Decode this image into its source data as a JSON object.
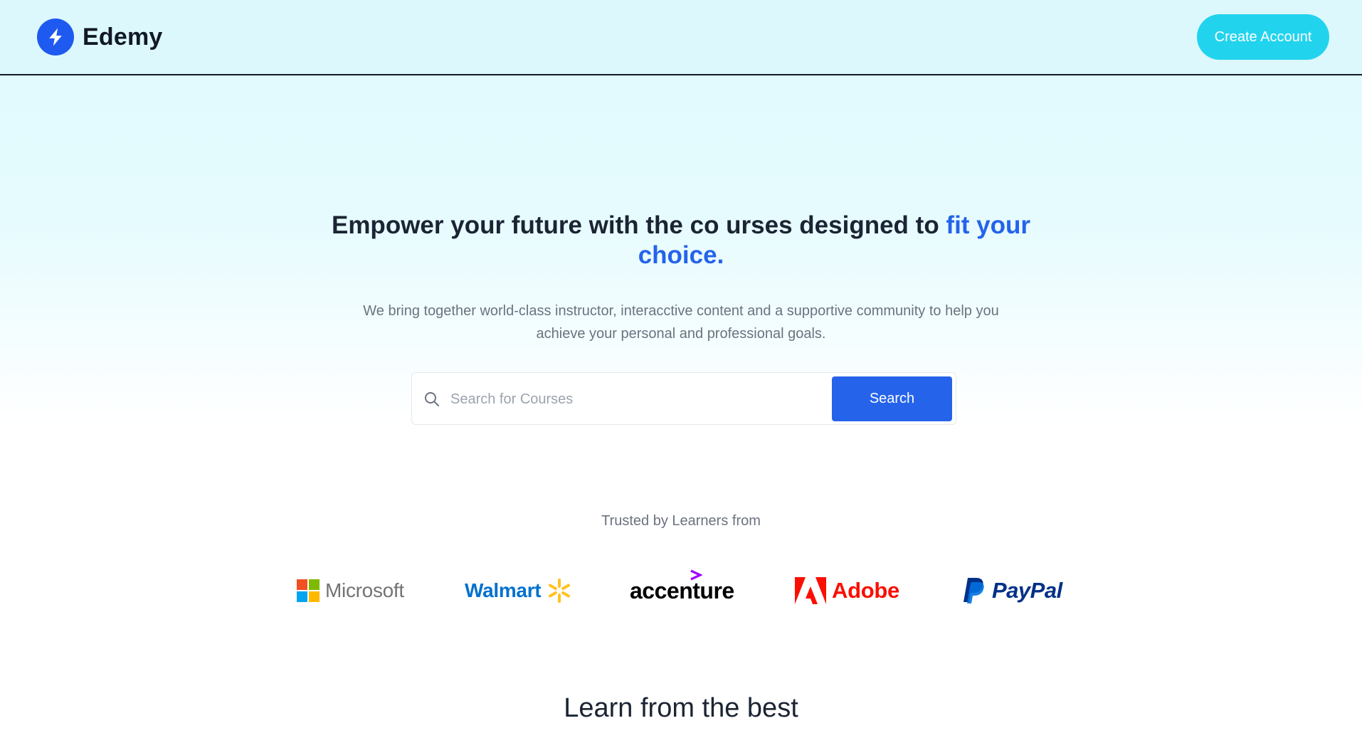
{
  "navbar": {
    "logo_text": "Edemy",
    "create_account_label": "Create Account"
  },
  "hero": {
    "title_main": "Empower your future with the co urses designed to ",
    "title_accent": "fit your choice.",
    "subtitle": "We bring together world-class instructor, interacctive content and a supportive community to help you achieve your personal and professional goals."
  },
  "search": {
    "placeholder": "Search for Courses",
    "button_label": "Search"
  },
  "trusted": {
    "label": "Trusted by Learners from",
    "companies": [
      "Microsoft",
      "Walmart",
      "accenture",
      "Adobe",
      "PayPal"
    ]
  },
  "learn_section": {
    "title": "Learn from the best"
  },
  "colors": {
    "accent": "#2563eb",
    "cta": "#22d3ee",
    "navbar_bg": "#dcf8fc"
  }
}
